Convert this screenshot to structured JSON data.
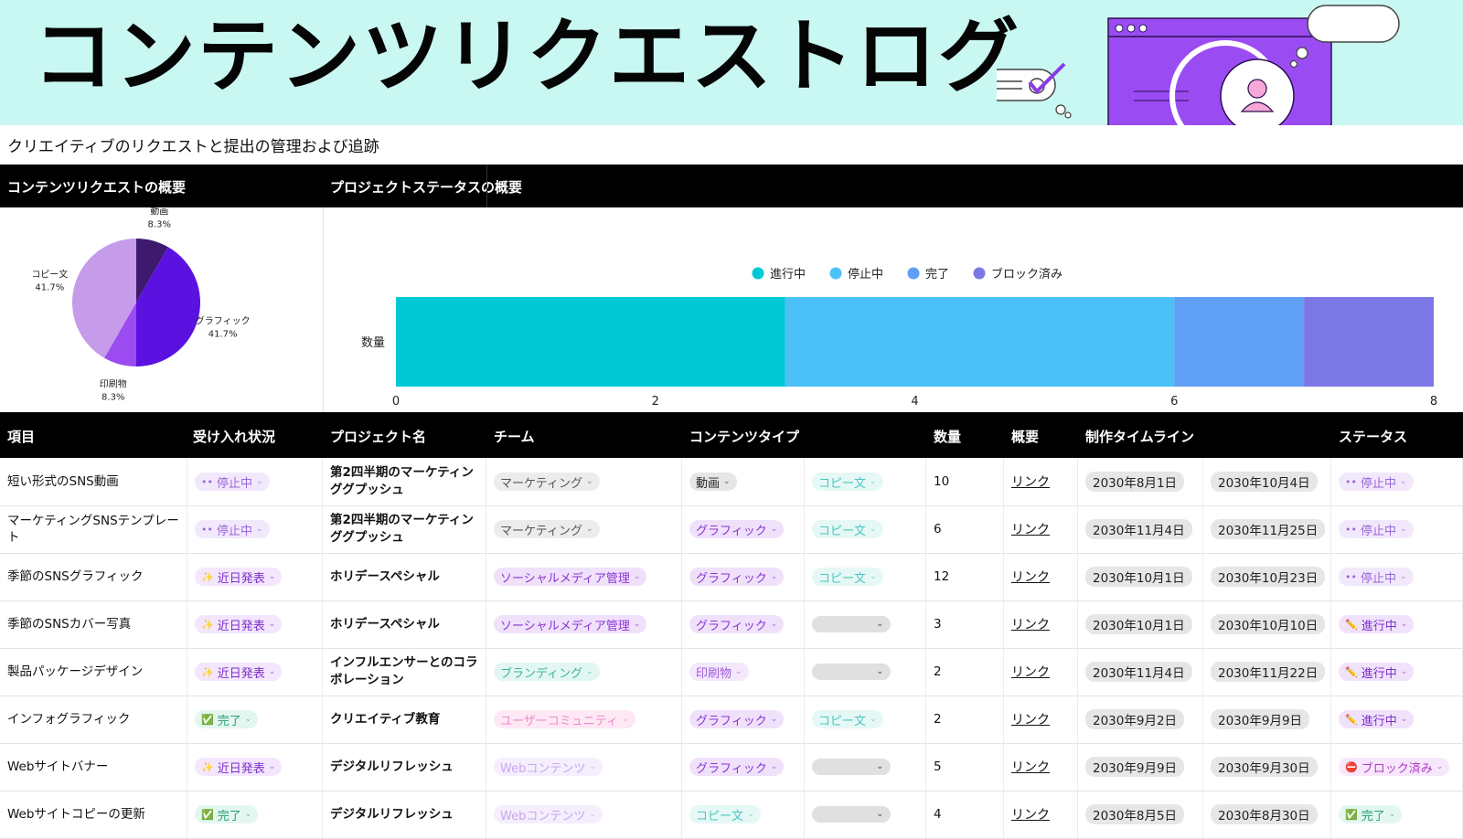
{
  "header": {
    "title": "コンテンツリクエストログ",
    "subtitle": "クリエイティブのリクエストと提出の管理および追跡"
  },
  "sections": {
    "overview_left": "コンテンツリクエストの概要",
    "overview_right": "プロジェクトステータスの概要"
  },
  "chart_data": [
    {
      "type": "pie",
      "slices": [
        {
          "label": "動画",
          "value": 8.3,
          "display": "8.3%",
          "color": "#3d1a6e"
        },
        {
          "label": "グラフィック",
          "value": 41.7,
          "display": "41.7%",
          "color": "#5b12e0"
        },
        {
          "label": "印刷物",
          "value": 8.3,
          "display": "8.3%",
          "color": "#9b4bf0"
        },
        {
          "label": "コピー文",
          "value": 41.7,
          "display": "41.7%",
          "color": "#c59bea"
        }
      ]
    },
    {
      "type": "bar",
      "orientation": "horizontal-stacked",
      "category_label": "数量",
      "xlim": [
        0,
        8
      ],
      "xticks": [
        "0",
        "2",
        "4",
        "6",
        "8"
      ],
      "legend_position": "top",
      "series": [
        {
          "name": "進行中",
          "value": 3,
          "color": "#00c9d6"
        },
        {
          "name": "停止中",
          "value": 3,
          "color": "#4bc1f7"
        },
        {
          "name": "完了",
          "value": 1,
          "color": "#5f9ff5"
        },
        {
          "name": "ブロック済み",
          "value": 1,
          "color": "#7b78e6"
        }
      ]
    }
  ],
  "table": {
    "headers": {
      "item": "項目",
      "acceptance": "受け入れ状況",
      "project": "プロジェクト名",
      "team": "チーム",
      "content_type": "コンテンツタイプ",
      "quantity": "数量",
      "summary": "概要",
      "timeline": "制作タイムライン",
      "status": "ステータス"
    },
    "rows": [
      {
        "item": "短い形式のSNS動画",
        "acceptance": "停止中",
        "project": "第2四半期のマーケティンググプッシュ",
        "team": "マーケティング",
        "type1": "動画",
        "type2": "コピー文",
        "qty": "10",
        "summary": "リンク",
        "start": "2030年8月1日",
        "end": "2030年10月4日",
        "status": "停止中"
      },
      {
        "item": "マーケティングSNSテンプレート",
        "acceptance": "停止中",
        "project": "第2四半期のマーケティンググプッシュ",
        "team": "マーケティング",
        "type1": "グラフィック",
        "type2": "コピー文",
        "qty": "6",
        "summary": "リンク",
        "start": "2030年11月4日",
        "end": "2030年11月25日",
        "status": "停止中"
      },
      {
        "item": "季節のSNSグラフィック",
        "acceptance": "近日発表",
        "project": "ホリデースペシャル",
        "team": "ソーシャルメディア管理",
        "type1": "グラフィック",
        "type2": "コピー文",
        "qty": "12",
        "summary": "リンク",
        "start": "2030年10月1日",
        "end": "2030年10月23日",
        "status": "停止中"
      },
      {
        "item": "季節のSNSカバー写真",
        "acceptance": "近日発表",
        "project": "ホリデースペシャル",
        "team": "ソーシャルメディア管理",
        "type1": "グラフィック",
        "type2": "",
        "qty": "3",
        "summary": "リンク",
        "start": "2030年10月1日",
        "end": "2030年10月10日",
        "status": "進行中"
      },
      {
        "item": "製品パッケージデザイン",
        "acceptance": "近日発表",
        "project": "インフルエンサーとのコラボレーション",
        "team": "ブランディング",
        "type1": "印刷物",
        "type2": "",
        "qty": "2",
        "summary": "リンク",
        "start": "2030年11月4日",
        "end": "2030年11月22日",
        "status": "進行中"
      },
      {
        "item": "インフォグラフィック",
        "acceptance": "完了",
        "project": "クリエイティブ教育",
        "team": "ユーザーコミュニティ",
        "type1": "グラフィック",
        "type2": "コピー文",
        "qty": "2",
        "summary": "リンク",
        "start": "2030年9月2日",
        "end": "2030年9月9日",
        "status": "進行中"
      },
      {
        "item": "Webサイトバナー",
        "acceptance": "近日発表",
        "project": "デジタルリフレッシュ",
        "team": "Webコンテンツ",
        "type1": "グラフィック",
        "type2": "",
        "qty": "5",
        "summary": "リンク",
        "start": "2030年9月9日",
        "end": "2030年9月30日",
        "status": "ブロック済み"
      },
      {
        "item": "Webサイトコピーの更新",
        "acceptance": "完了",
        "project": "デジタルリフレッシュ",
        "team": "Webコンテンツ",
        "type1": "コピー文",
        "type2": "",
        "qty": "4",
        "summary": "リンク",
        "start": "2030年8月5日",
        "end": "2030年8月30日",
        "status": "完了"
      }
    ]
  },
  "colors": {
    "banner_bg": "#c9f7f1",
    "header_bg": "#000000",
    "accent_purple": "#9a4cf2"
  }
}
